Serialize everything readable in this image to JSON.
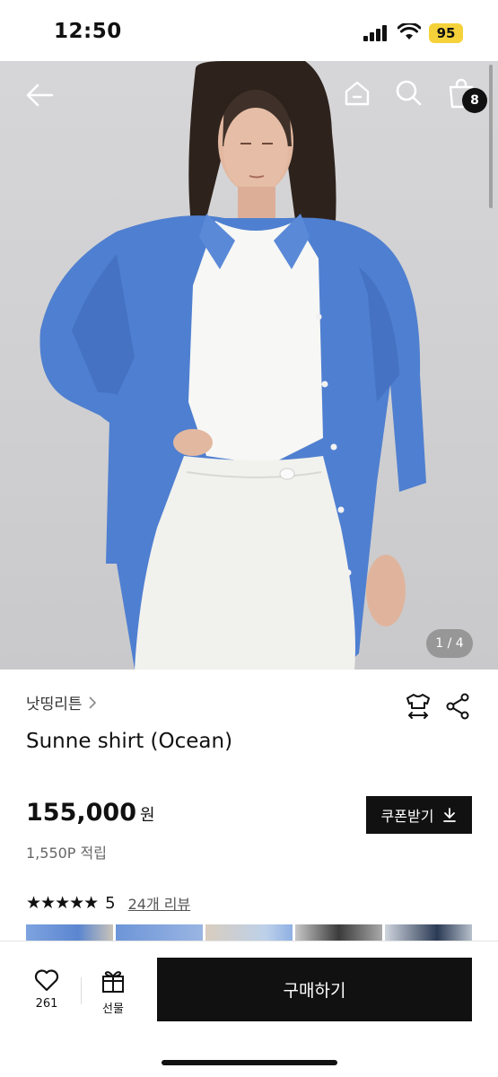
{
  "status_bar": {
    "time": "12:50",
    "battery": "95"
  },
  "header": {
    "cart_count": "8"
  },
  "gallery": {
    "page_indicator": "1 / 4",
    "current": 1,
    "total": 4
  },
  "product": {
    "brand": "낫띵리튼",
    "name": "Sunne shirt (Ocean)",
    "price": "155,000",
    "currency": "원",
    "points": "1,550P 적립",
    "coupon_label": "쿠폰받기",
    "rating_stars": "★★★★★",
    "rating_value": "5",
    "review_link": "24개 리뷰"
  },
  "bottom_bar": {
    "like_count": "261",
    "gift_label": "선물",
    "buy_label": "구매하기"
  },
  "colors": {
    "accent": "#111111",
    "shirt": "#4f7fd0",
    "badge_yellow": "#f5d23a"
  }
}
